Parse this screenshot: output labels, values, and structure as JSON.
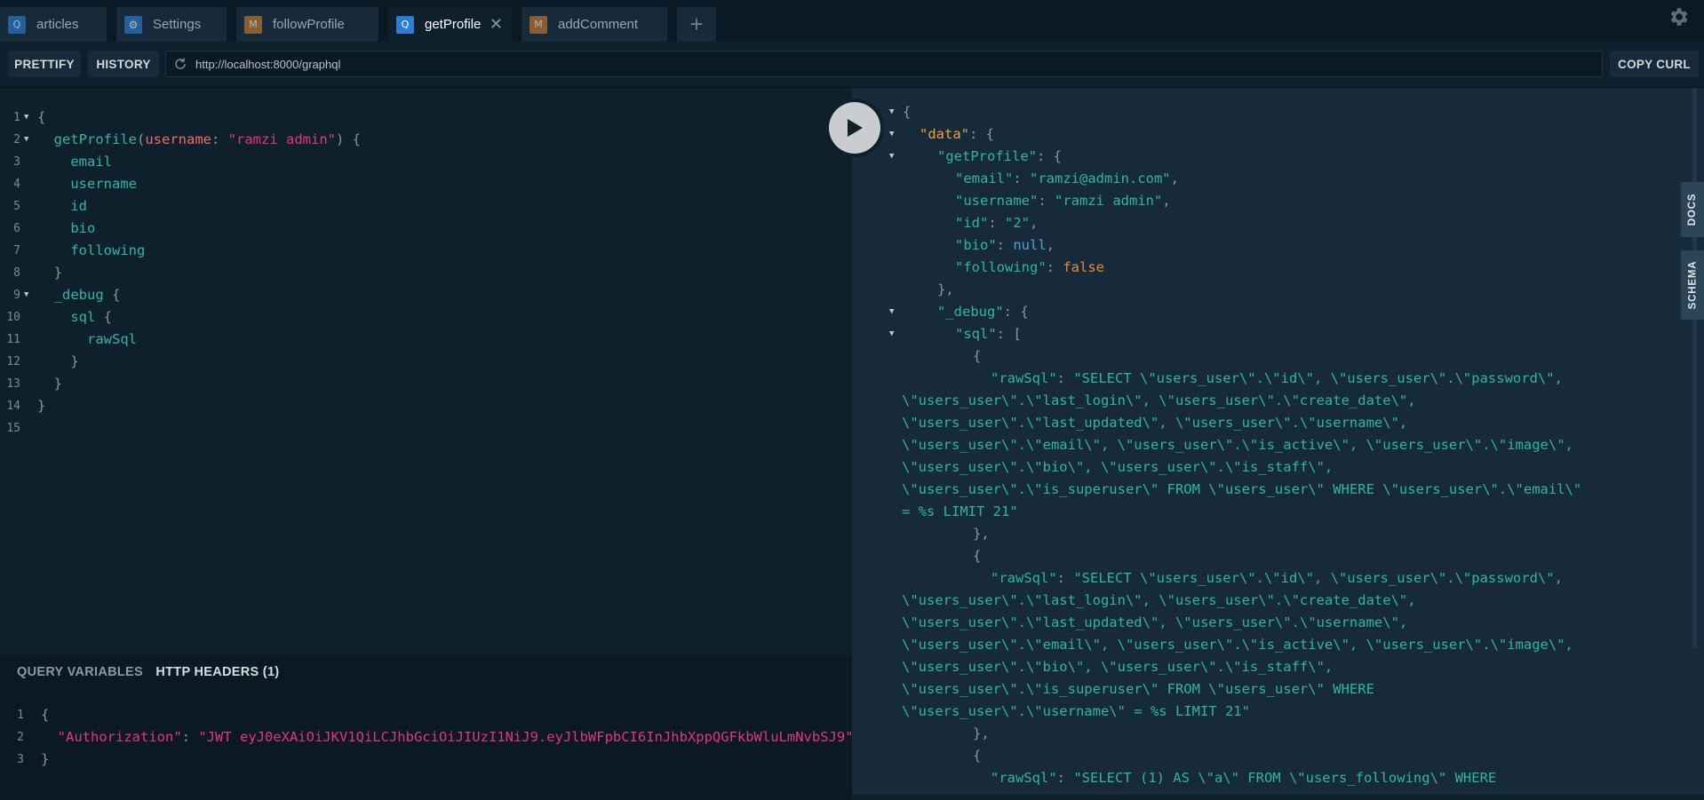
{
  "tabs": [
    {
      "badge": "Q",
      "label": "articles"
    },
    {
      "badge": "⚙",
      "label": "Settings"
    },
    {
      "badge": "M",
      "label": "followProfile"
    },
    {
      "badge": "Q",
      "label": "getProfile",
      "active": true
    },
    {
      "badge": "M",
      "label": "addComment"
    }
  ],
  "toolbar": {
    "prettify": "PRETTIFY",
    "history": "HISTORY",
    "url": "http://localhost:8000/graphql",
    "copy_curl": "COPY CURL"
  },
  "query_lines": {
    "l1": "{",
    "l2_field": "getProfile",
    "l2_arg": "username",
    "l2_str": "\"ramzi admin\"",
    "l3": "email",
    "l4": "username",
    "l5": "id",
    "l6": "bio",
    "l7": "following",
    "l8": "}",
    "l9_field": "_debug",
    "l10_field": "sql",
    "l11": "rawSql",
    "l12": "}",
    "l13": "}",
    "l14": "}"
  },
  "lower_panel": {
    "tab_variables": "QUERY VARIABLES",
    "tab_headers": "HTTP HEADERS (1)",
    "header_key": "\"Authorization\"",
    "header_value": "\"JWT eyJ0eXAiOiJKV1QiLCJhbGciOiJIUzI1NiJ9.eyJlbWFpbCI6InJhbXppQGFkbWluLmNvbSJ9\""
  },
  "result": {
    "data_key": "\"data\"",
    "getProfile_key": "\"getProfile\"",
    "email_key": "\"email\"",
    "email_val": "\"ramzi@admin.com\"",
    "username_key": "\"username\"",
    "username_val": "\"ramzi admin\"",
    "id_key": "\"id\"",
    "id_val": "\"2\"",
    "bio_key": "\"bio\"",
    "bio_val": "null",
    "following_key": "\"following\"",
    "following_val": "false",
    "debug_key": "\"_debug\"",
    "sql_key": "\"sql\"",
    "rawSql_key": "\"rawSql\"",
    "sql1": [
      "\"SELECT \\\"users_user\\\".\\\"id\\\", \\\"users_user\\\".\\\"password\\\",",
      "\\\"users_user\\\".\\\"last_login\\\", \\\"users_user\\\".\\\"create_date\\\",",
      "\\\"users_user\\\".\\\"last_updated\\\", \\\"users_user\\\".\\\"username\\\",",
      "\\\"users_user\\\".\\\"email\\\", \\\"users_user\\\".\\\"is_active\\\", \\\"users_user\\\".\\\"image\\\",",
      "\\\"users_user\\\".\\\"bio\\\", \\\"users_user\\\".\\\"is_staff\\\",",
      "\\\"users_user\\\".\\\"is_superuser\\\" FROM \\\"users_user\\\" WHERE \\\"users_user\\\".\\\"email\\\"",
      "= %s LIMIT 21\""
    ],
    "sql2": [
      "\"SELECT \\\"users_user\\\".\\\"id\\\", \\\"users_user\\\".\\\"password\\\",",
      "\\\"users_user\\\".\\\"last_login\\\", \\\"users_user\\\".\\\"create_date\\\",",
      "\\\"users_user\\\".\\\"last_updated\\\", \\\"users_user\\\".\\\"username\\\",",
      "\\\"users_user\\\".\\\"email\\\", \\\"users_user\\\".\\\"is_active\\\", \\\"users_user\\\".\\\"image\\\",",
      "\\\"users_user\\\".\\\"bio\\\", \\\"users_user\\\".\\\"is_staff\\\",",
      "\\\"users_user\\\".\\\"is_superuser\\\" FROM \\\"users_user\\\" WHERE",
      "\\\"users_user\\\".\\\"username\\\" = %s LIMIT 21\""
    ],
    "sql3_start": "\"SELECT (1) AS \\\"a\\\" FROM \\\"users_following\\\" WHERE"
  },
  "side_tabs": {
    "docs": "DOCS",
    "schema": "SCHEMA"
  }
}
